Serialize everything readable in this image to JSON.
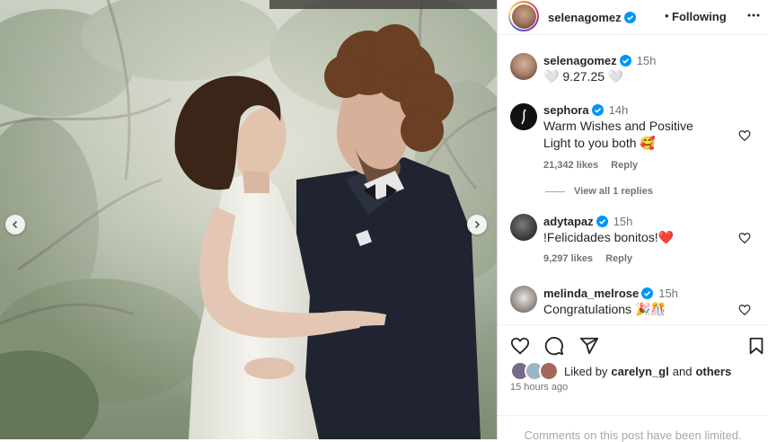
{
  "header": {
    "username": "selenagomez",
    "separator": "•",
    "follow_status": "Following"
  },
  "caption": {
    "username": "selenagomez",
    "time": "15h",
    "text": "🤍 9.27.25 🤍"
  },
  "comments": [
    {
      "username": "sephora",
      "time": "14h",
      "text_line1": "Warm Wishes and Positive",
      "text_line2": "Light to you both 🥰",
      "likes": "21,342 likes",
      "reply": "Reply",
      "view_replies": "View all 1 replies"
    },
    {
      "username": "adytapaz",
      "time": "15h",
      "text": "!Felicidades bonitos!❤️",
      "likes": "9,297 likes",
      "reply": "Reply"
    },
    {
      "username": "melinda_melrose",
      "time": "15h",
      "text": "Congratulations 🎉🎊"
    }
  ],
  "likes": {
    "prefix": "Liked by",
    "user": "carelyn_gl",
    "connector": "and",
    "others": "others"
  },
  "timestamp": "15 hours ago",
  "footer": {
    "limited": "Comments on this post have been limited."
  },
  "colors": {
    "verified": "#0095f6",
    "text": "#262626",
    "secondary": "#737373"
  },
  "icons": [
    "verified-badge-icon",
    "more-options-icon",
    "heart-icon",
    "comment-icon",
    "share-icon",
    "bookmark-icon",
    "chevron-left-icon",
    "chevron-right-icon"
  ]
}
